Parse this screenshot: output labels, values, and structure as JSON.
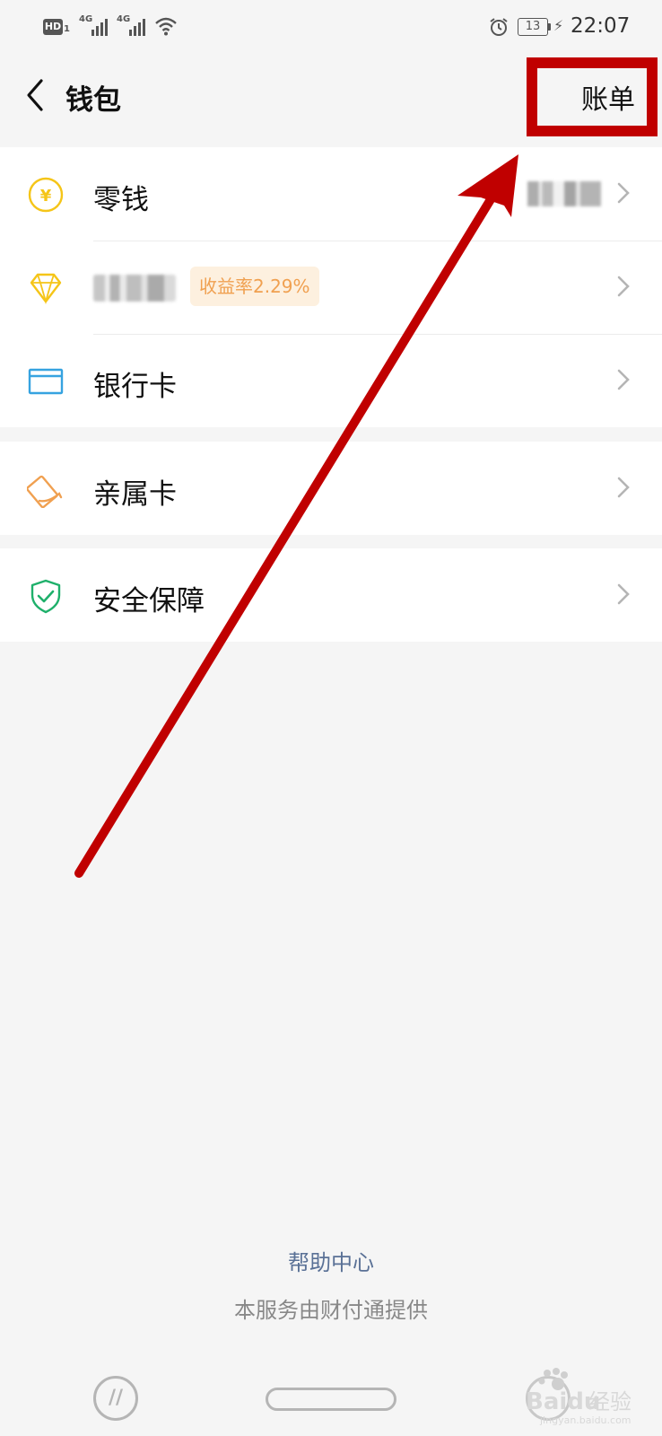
{
  "status_bar": {
    "hd_label": "HD",
    "hd_sub": "1",
    "net_label_1": "4G",
    "net_label_2": "4G",
    "battery_level": "13",
    "time": "22:07"
  },
  "nav": {
    "title": "钱包",
    "right_action": "账单"
  },
  "wallet_items": [
    {
      "label": "零钱",
      "icon": "yuan-coin-icon"
    },
    {
      "label": "",
      "badge": "收益率2.29%",
      "icon": "diamond-icon"
    },
    {
      "label": "银行卡",
      "icon": "bank-card-icon"
    }
  ],
  "family_card": {
    "label": "亲属卡",
    "icon": "family-card-icon"
  },
  "security": {
    "label": "安全保障",
    "icon": "shield-check-icon"
  },
  "footer": {
    "help": "帮助中心",
    "provider": "本服务由财付通提供"
  },
  "watermark": {
    "brand": "Baidu",
    "text": "经验",
    "url": "jingyan.baidu.com"
  },
  "colors": {
    "annotation_red": "#c00000",
    "coin_yellow": "#f5c518",
    "bank_blue": "#36a3e0",
    "family_orange": "#f0a050",
    "security_green": "#1fb06b",
    "help_link": "#5a7196",
    "badge_bg": "#fdf0df"
  }
}
